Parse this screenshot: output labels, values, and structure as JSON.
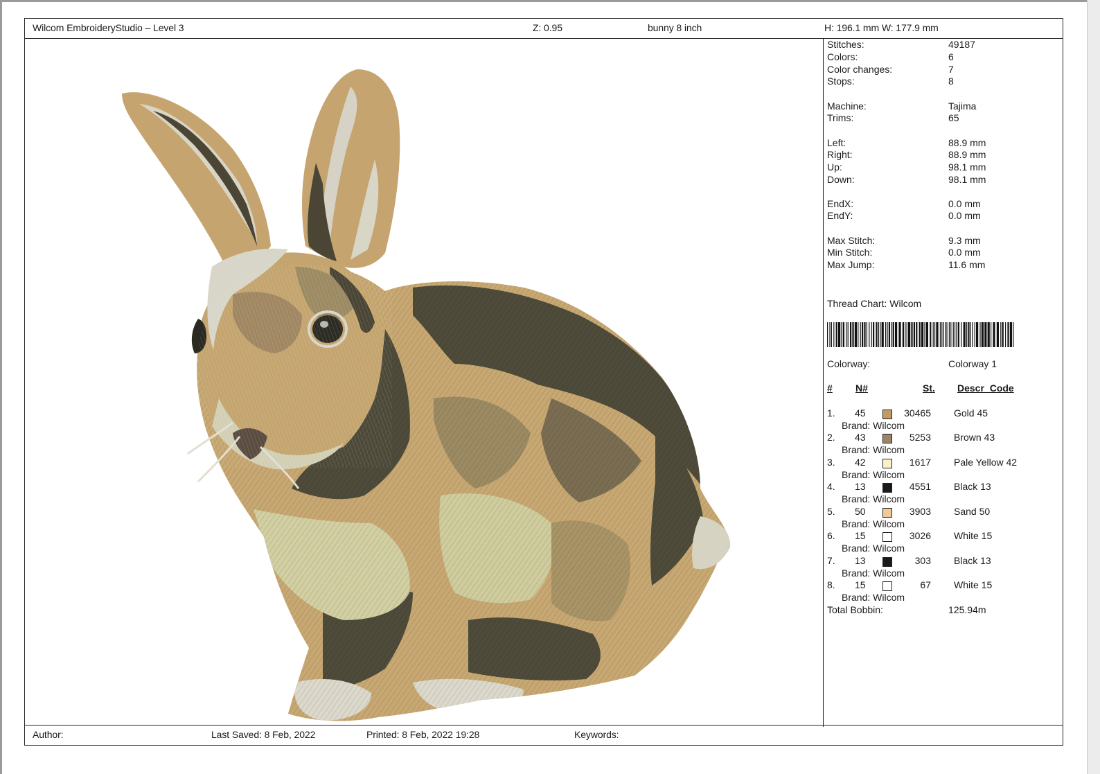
{
  "header": {
    "app_title": "Wilcom EmbroideryStudio – Level 3",
    "zoom": "Z: 0.95",
    "design_name": "bunny 8  inch",
    "dimensions": "H: 196.1 mm   W: 177.9 mm"
  },
  "stats": [
    {
      "label": "Stitches:",
      "value": "49187"
    },
    {
      "label": "Colors:",
      "value": "6"
    },
    {
      "label": "Color changes:",
      "value": "7"
    },
    {
      "label": "Stops:",
      "value": "8"
    },
    {
      "label": "Machine:",
      "value": "Tajima"
    },
    {
      "label": "Trims:",
      "value": "65"
    },
    {
      "label": "Left:",
      "value": "88.9 mm"
    },
    {
      "label": "Right:",
      "value": "88.9 mm"
    },
    {
      "label": "Up:",
      "value": "98.1 mm"
    },
    {
      "label": "Down:",
      "value": "98.1 mm"
    },
    {
      "label": "EndX:",
      "value": "0.0 mm"
    },
    {
      "label": "EndY:",
      "value": "0.0 mm"
    },
    {
      "label": "Max Stitch:",
      "value": "9.3 mm"
    },
    {
      "label": "Min Stitch:",
      "value": "0.0 mm"
    },
    {
      "label": "Max Jump:",
      "value": "11.6 mm"
    }
  ],
  "thread_chart": "Thread Chart: Wilcom",
  "colorway": {
    "label": "Colorway:",
    "value": "Colorway 1"
  },
  "table_headers": {
    "index": "#",
    "number": "N#",
    "stitches": "St.",
    "description": "Descr_Code"
  },
  "threads": [
    {
      "index": "1.",
      "number": "45",
      "color": "#c29a68",
      "stitches": "30465",
      "description": "Gold 45",
      "brand": "Brand: Wilcom"
    },
    {
      "index": "2.",
      "number": "43",
      "color": "#9c8468",
      "stitches": "5253",
      "description": "Brown 43",
      "brand": "Brand: Wilcom"
    },
    {
      "index": "3.",
      "number": "42",
      "color": "#fbf1c4",
      "stitches": "1617",
      "description": "Pale Yellow 42",
      "brand": "Brand: Wilcom"
    },
    {
      "index": "4.",
      "number": "13",
      "color": "#1a1a1a",
      "stitches": "4551",
      "description": "Black 13",
      "brand": "Brand: Wilcom"
    },
    {
      "index": "5.",
      "number": "50",
      "color": "#f2c99a",
      "stitches": "3903",
      "description": "Sand 50",
      "brand": "Brand: Wilcom"
    },
    {
      "index": "6.",
      "number": "15",
      "color": "#ffffff",
      "stitches": "3026",
      "description": "White 15",
      "brand": "Brand: Wilcom"
    },
    {
      "index": "7.",
      "number": "13",
      "color": "#1a1a1a",
      "stitches": "303",
      "description": "Black 13",
      "brand": "Brand: Wilcom"
    },
    {
      "index": "8.",
      "number": "15",
      "color": "#ffffff",
      "stitches": "67",
      "description": "White 15",
      "brand": "Brand: Wilcom"
    }
  ],
  "total_bobbin": {
    "label": "Total Bobbin:",
    "value": "125.94m"
  },
  "footer": {
    "author": "Author:",
    "last_saved": "Last Saved:  8 Feb, 2022",
    "printed": "Printed:  8 Feb, 2022 19:28",
    "keywords": "Keywords:"
  },
  "artwork": {
    "subject": "embroidered bunny design"
  }
}
